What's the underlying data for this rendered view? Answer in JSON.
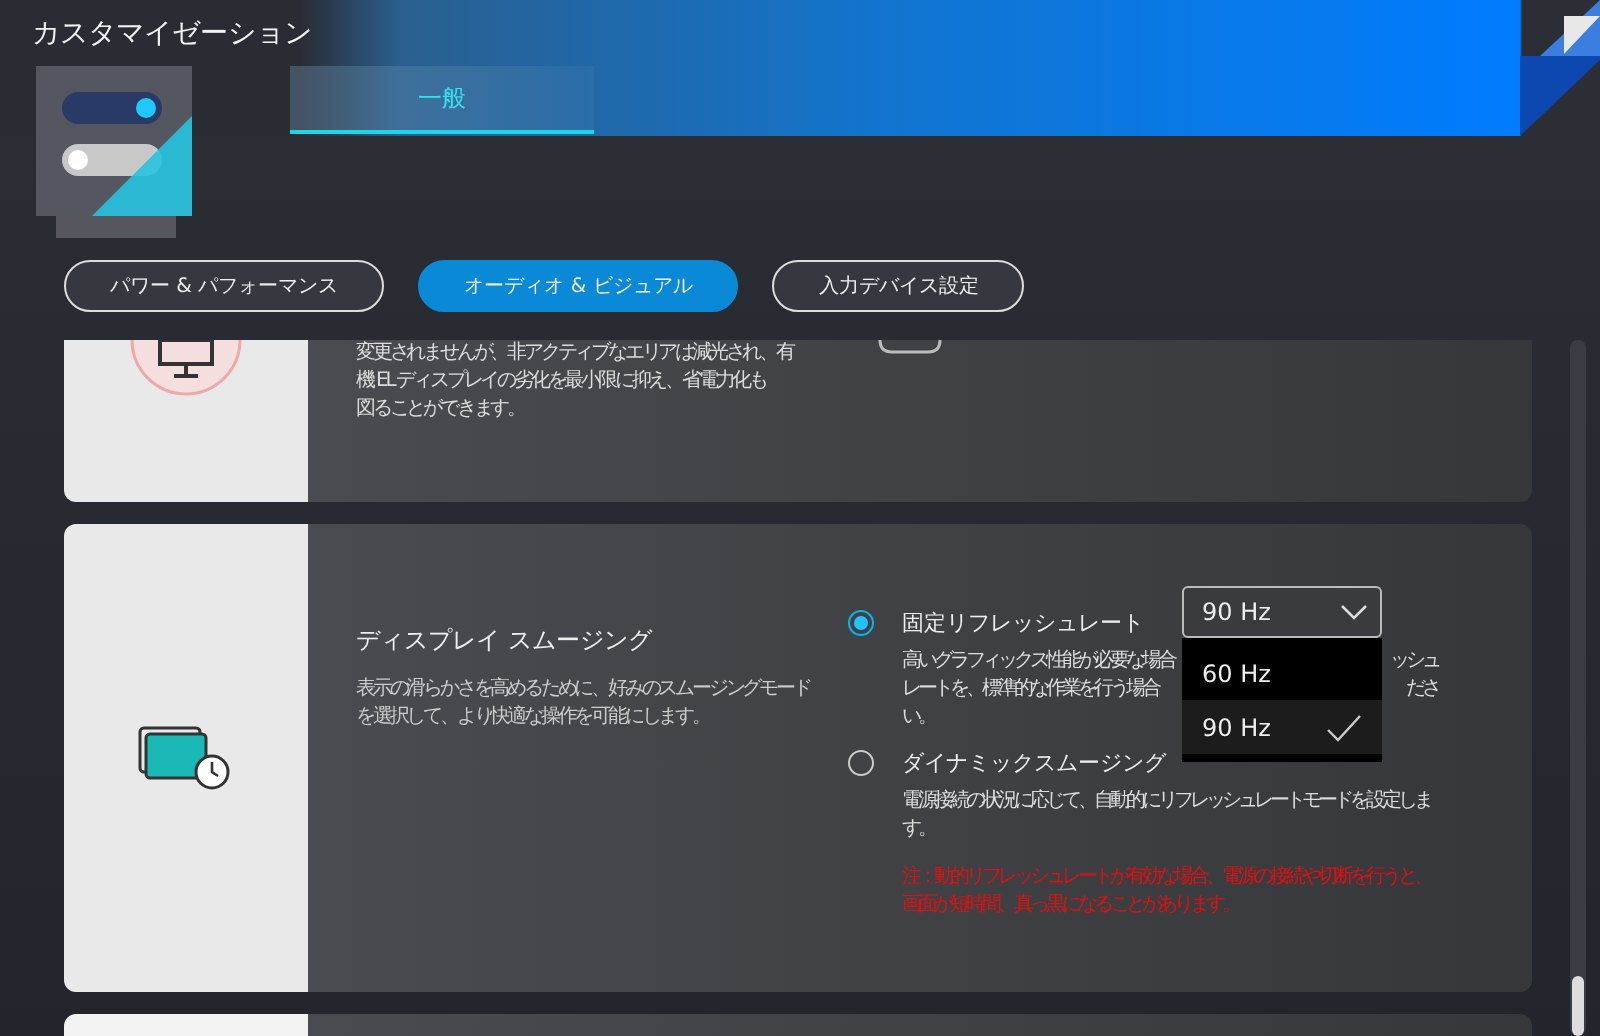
{
  "window": {
    "title": "カスタマイゼーション"
  },
  "tabs": [
    {
      "label": "一般",
      "selected": true
    }
  ],
  "categories": [
    {
      "label": "パワー & パフォーマンス",
      "selected": false
    },
    {
      "label": "オーディオ & ビジュアル",
      "selected": true
    },
    {
      "label": "入力デバイス設定",
      "selected": false
    }
  ],
  "cards": [
    {
      "kind": "partial",
      "description_lines": [
        "変更されませんが、非アクティブなエリアは減光され、有",
        "機 EL ディスプレイの劣化を最小限に抑え、省電力化も",
        "図ることができます。"
      ]
    },
    {
      "kind": "setting",
      "title": "ディスプレイ スムージング",
      "description": "表示の滑らかさを高めるために、好みのスムージングモードを選択して、より快適な操作を可能にします。",
      "options": [
        {
          "label": "固定リフレッシュレート",
          "selected": true,
          "description_lines": [
            {
              "start": "高いグラフィックス性能が必要な場合",
              "end": "ッシュ"
            },
            {
              "start": "レートを、標準的な作業を行う場合",
              "end": "ださ"
            },
            {
              "start": "い。"
            }
          ]
        },
        {
          "label": "ダイナミックスムージング",
          "selected": false,
          "description": "電源接続の状況に応じて、自動的にリフレッシュレートモードを設定します。",
          "note": "注：動的リフレッシュレートが有効な場合、電源の接続や切断を行うと、画面が短時間、真っ黒になることがあります。"
        }
      ],
      "dropdown": {
        "value": "90 Hz",
        "expanded": true,
        "options": [
          {
            "label": "60 Hz",
            "selected": false
          },
          {
            "label": "90 Hz",
            "selected": true
          }
        ]
      }
    },
    {
      "kind": "blank"
    }
  ]
}
